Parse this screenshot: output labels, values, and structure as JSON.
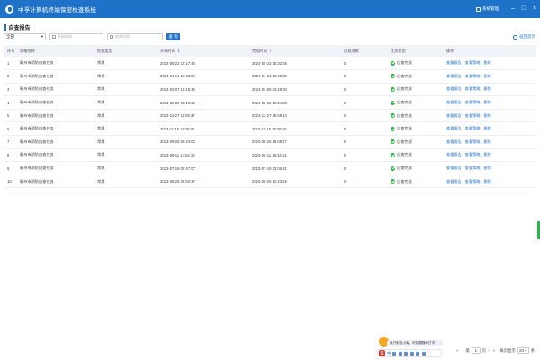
{
  "app": {
    "title": "中孚计算机终端保密检查系统",
    "user_label": "系统管理",
    "window_controls": [
      "–",
      "□",
      "×"
    ],
    "accent_color": "#1e73c9"
  },
  "page": {
    "title": "自查报告",
    "back_label": "返回首页"
  },
  "filter": {
    "select_value": "全部",
    "start_placeholder": "开始时间",
    "end_placeholder": "结束时间",
    "query_label": "查 询"
  },
  "table": {
    "headers": [
      "序号",
      "策略名称",
      "检查类型",
      "开始时间",
      "完成时间",
      "违规项数",
      "任务状态",
      "操作"
    ],
    "operations": [
      "查看报告",
      "查看策略",
      "删除"
    ],
    "rows": [
      {
        "idx": "1",
        "name": "赣州市消防自查任务",
        "type": "常规",
        "start": "2024-05-22 10:17:44",
        "end": "2024-05-23 15:32:55",
        "count": "0",
        "status": "自查完成"
      },
      {
        "idx": "2",
        "name": "赣州市消防自查任务",
        "type": "常规",
        "start": "2024-04-14 16:43:56",
        "end": "2024-04-24 13:43:39",
        "count": "0",
        "status": "自查完成"
      },
      {
        "idx": "3",
        "name": "赣州市消防自查任务",
        "type": "常规",
        "start": "2024-03-07 10:15:45",
        "end": "2024-03-09 04:28:00",
        "count": "0",
        "status": "自查完成"
      },
      {
        "idx": "4",
        "name": "赣州市消防自查任务",
        "type": "常规",
        "start": "2024-02-05 09:19:23",
        "end": "2024-02-05 19:24:38",
        "count": "0",
        "status": "自查完成"
      },
      {
        "idx": "5",
        "name": "赣州市消防自查任务",
        "type": "常规",
        "start": "2023-12-27 11:09:37",
        "end": "2023-12-27 16:59:13",
        "count": "0",
        "status": "自查完成"
      },
      {
        "idx": "6",
        "name": "赣州市消防自查任务",
        "type": "常规",
        "start": "2023-11-15 11:26:09",
        "end": "2023-11-15 20:26:26",
        "count": "0",
        "status": "自查完成"
      },
      {
        "idx": "7",
        "name": "赣州市消防自查任务",
        "type": "常规",
        "start": "2023-09-25 06:24:02",
        "end": "2023-09-25 16:08:27",
        "count": "0",
        "status": "自查完成"
      },
      {
        "idx": "8",
        "name": "赣州市消防自查任务",
        "type": "常规",
        "start": "2023-08-11 14:54:19",
        "end": "2023-08-11 19:34:14",
        "count": "0",
        "status": "自查完成"
      },
      {
        "idx": "9",
        "name": "赣州市消防自查任务",
        "type": "常规",
        "start": "2023-07-19 09:47:07",
        "end": "2023-07-19 13:06:51",
        "count": "0",
        "status": "自查完成"
      },
      {
        "idx": "10",
        "name": "赣州市消防自查任务",
        "type": "常规",
        "start": "2023-06-25 08:52:37",
        "end": "2023-06-25 12:23:19",
        "count": "0",
        "status": "自查完成"
      }
    ]
  },
  "ime": {
    "bubble": "养只彩色小兔，时刻跟随你打字",
    "logo": "S",
    "mode_label": "中"
  },
  "pager": {
    "first": "«",
    "prev": "‹",
    "prefix": "第",
    "page": "1",
    "suffix": "页",
    "next": "›",
    "last": "»",
    "size_label": "每页显示",
    "size": "20",
    "unit": "条"
  },
  "colors": {
    "status_ok": "#2fb344",
    "side_tab": "#2fb344"
  }
}
